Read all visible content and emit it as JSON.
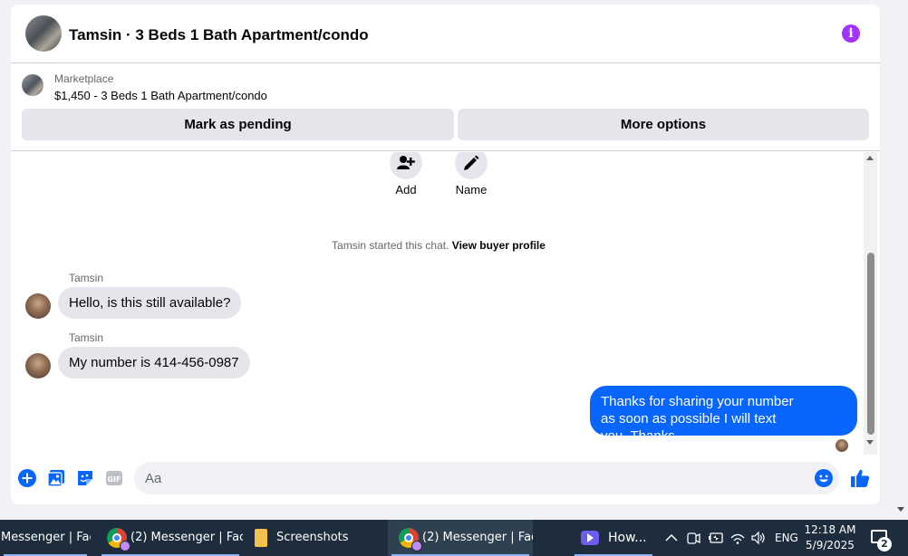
{
  "chat": {
    "header": {
      "title": "Tamsin · 3 Beds 1 Bath Apartment/condo",
      "info_icon": "info-icon"
    },
    "marketplace": {
      "label": "Marketplace",
      "listing": "$1,450 - 3 Beds 1 Bath Apartment/condo",
      "mark_pending_label": "Mark as pending",
      "more_options_label": "More options"
    },
    "actions": [
      {
        "label": "Add",
        "icon": "add-person-icon"
      },
      {
        "label": "Name",
        "icon": "pencil-icon"
      }
    ],
    "started_text": "Tamsin started this chat.",
    "view_buyer_profile": "View buyer profile",
    "messages": [
      {
        "sender": "Tamsin",
        "text": "Hello, is this still available?",
        "direction": "incoming"
      },
      {
        "sender": "Tamsin",
        "text": "My number is 414-456-0987",
        "direction": "incoming"
      },
      {
        "sender": "",
        "lines": [
          "Thanks for sharing your number",
          "as soon as possible I will text you..Thanks"
        ],
        "direction": "outgoing"
      }
    ],
    "composer": {
      "placeholder": "Aa",
      "value": "",
      "icons": [
        "plus-icon",
        "photo-icon",
        "sticker-icon",
        "gif-icon",
        "emoji-icon",
        "thumbs-up-icon"
      ]
    }
  },
  "colors": {
    "accent": "#0866ff",
    "info": "#a033ff",
    "bubble_in": "#e4e6eb",
    "taskbar": "#1d2d3d"
  },
  "taskbar": {
    "items": [
      {
        "label": "Messenger | Fac...",
        "icon": ""
      },
      {
        "label": "(2) Messenger | Fac...",
        "icon": "chrome-icon"
      },
      {
        "label": "Screenshots",
        "icon": "folder-icon"
      },
      {
        "label": "(2) Messenger | Fac...",
        "icon": "chrome-icon",
        "active": true
      },
      {
        "label": "How...",
        "icon": "zoom-icon"
      }
    ],
    "tray": {
      "language": "ENG",
      "time": "12:18 AM",
      "date": "5/9/2025",
      "notification_count": "2"
    }
  }
}
